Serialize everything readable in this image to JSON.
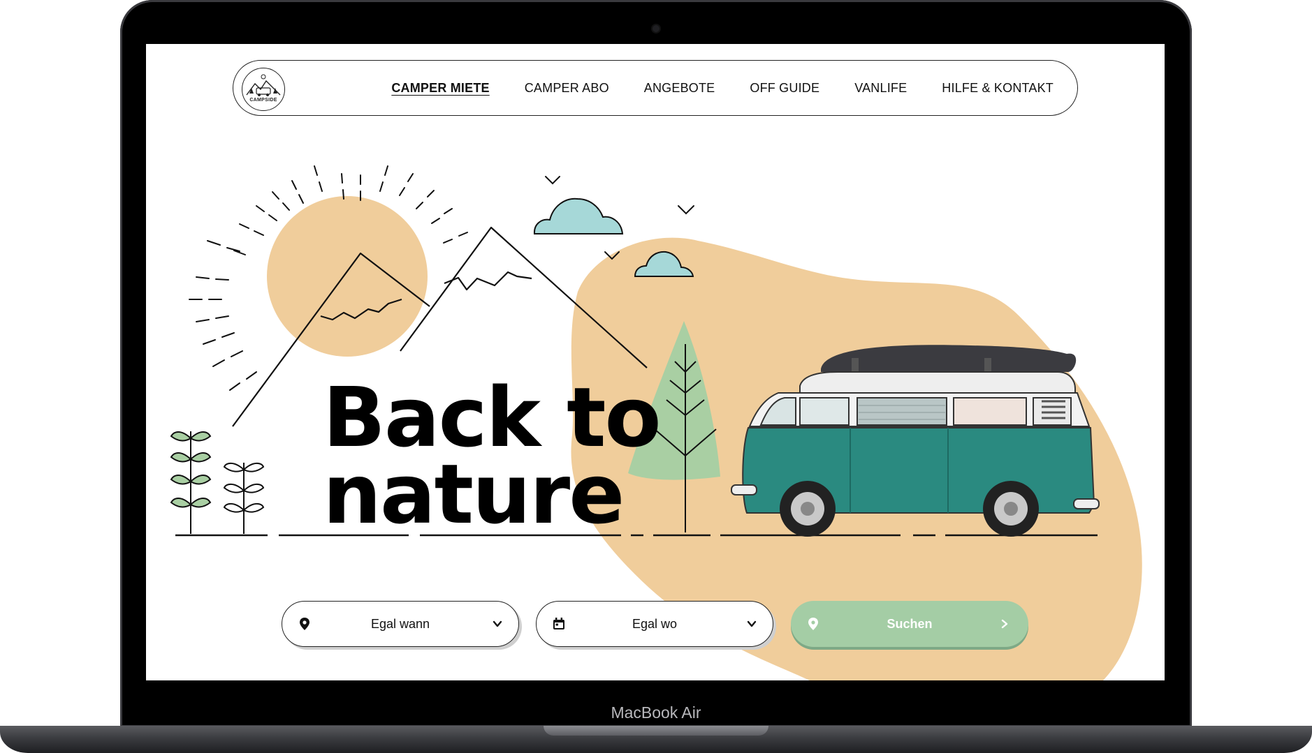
{
  "device": {
    "label": "MacBook Air"
  },
  "logo": {
    "text": "CAMPSIDE"
  },
  "nav": {
    "items": [
      {
        "label": "CAMPER MIETE",
        "active": true
      },
      {
        "label": "CAMPER ABO",
        "active": false
      },
      {
        "label": "ANGEBOTE",
        "active": false
      },
      {
        "label": "OFF GUIDE",
        "active": false
      },
      {
        "label": "VANLIFE",
        "active": false
      },
      {
        "label": "HILFE & KONTAKT",
        "active": false
      }
    ]
  },
  "hero": {
    "headline_line1": "Back to",
    "headline_line2": "nature"
  },
  "search": {
    "when_label": "Egal wann",
    "when_icon": "map-pin-icon",
    "where_label": "Egal wo",
    "where_icon": "calendar-icon",
    "submit_label": "Suchen",
    "submit_icon": "map-pin-icon"
  },
  "colors": {
    "sand": "#f0cd9b",
    "cloud": "#a6d8d8",
    "tree": "#a9cfa3",
    "van_teal": "#2a8a80",
    "button_green": "#a4cda5"
  }
}
